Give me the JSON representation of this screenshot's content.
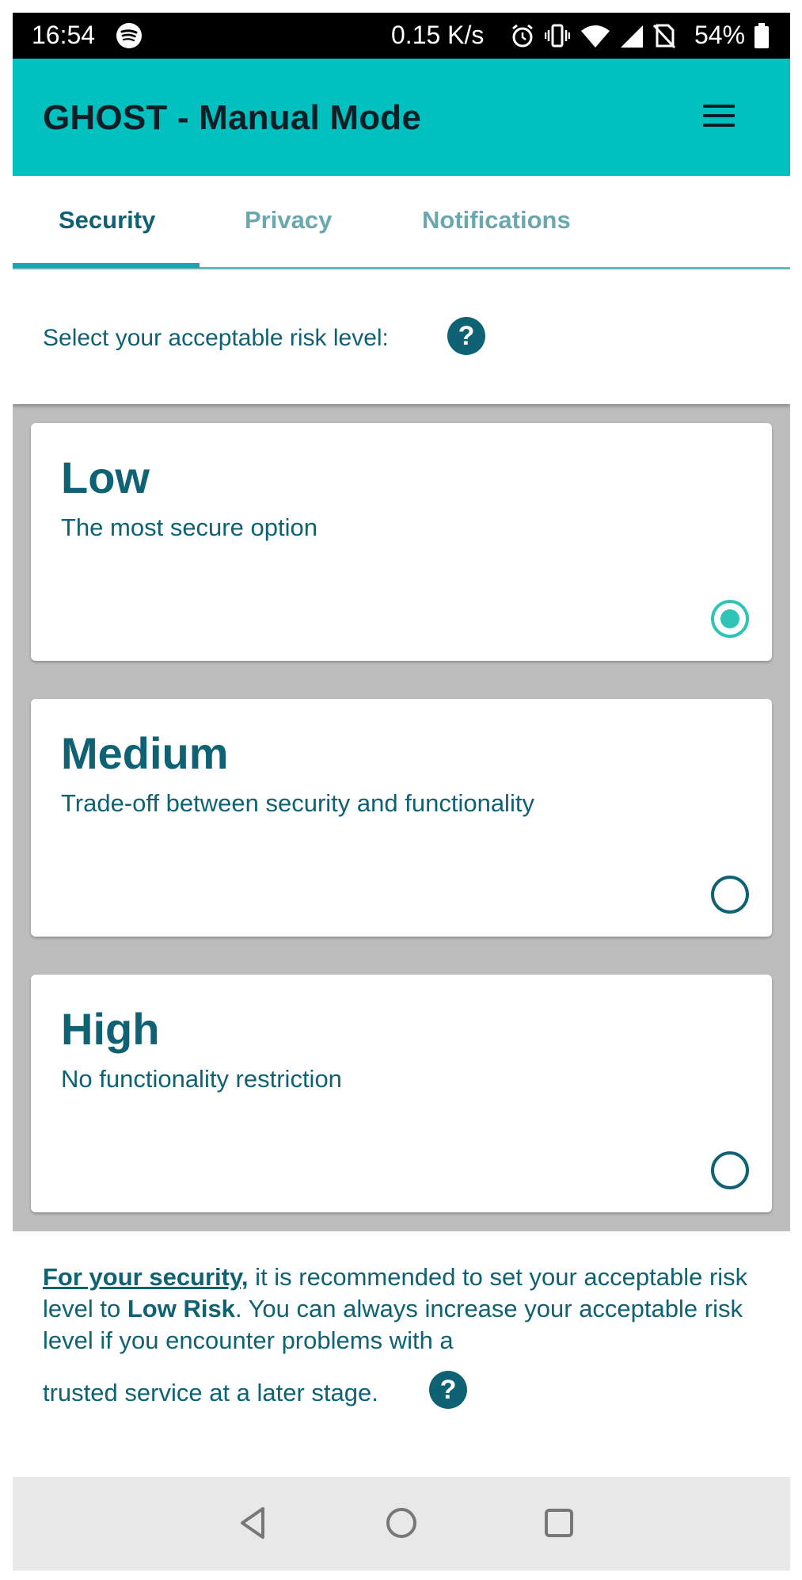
{
  "status_bar": {
    "time": "16:54",
    "network_speed": "0.15 K/s",
    "battery": "54%",
    "icons": [
      "spotify-icon",
      "alarm-icon",
      "vibrate-icon",
      "wifi-icon",
      "signal-icon",
      "no-sim-icon",
      "battery-icon"
    ]
  },
  "app_bar": {
    "title": "GHOST - Manual Mode",
    "menu_icon": "hamburger-menu-icon"
  },
  "tabs": [
    {
      "label": "Security",
      "active": true
    },
    {
      "label": "Privacy",
      "active": false
    },
    {
      "label": "Notifications",
      "active": false
    }
  ],
  "prompt": {
    "text": "Select your acceptable risk level:",
    "help_icon": "?"
  },
  "options": [
    {
      "title": "Low",
      "subtitle": "The most secure option",
      "selected": true
    },
    {
      "title": "Medium",
      "subtitle": "Trade-off between security and functionality",
      "selected": false
    },
    {
      "title": "High",
      "subtitle": "No functionality restriction",
      "selected": false
    }
  ],
  "recommendation": {
    "link": "For your security,",
    "part1": " it is recommended to set your acceptable risk level to ",
    "bold": "Low Risk",
    "part2": ". You can always increase your acceptable risk level if you encounter problems with a",
    "last_line": "trusted service at a later stage.",
    "help_icon": "?"
  },
  "nav_bar": {
    "buttons": [
      "back-icon",
      "home-icon",
      "recents-icon"
    ]
  },
  "colors": {
    "accent": "#00c0c0",
    "primary_text": "#0e6273",
    "radio_selected": "#2ec4b6",
    "list_background": "#bdbdbd"
  }
}
